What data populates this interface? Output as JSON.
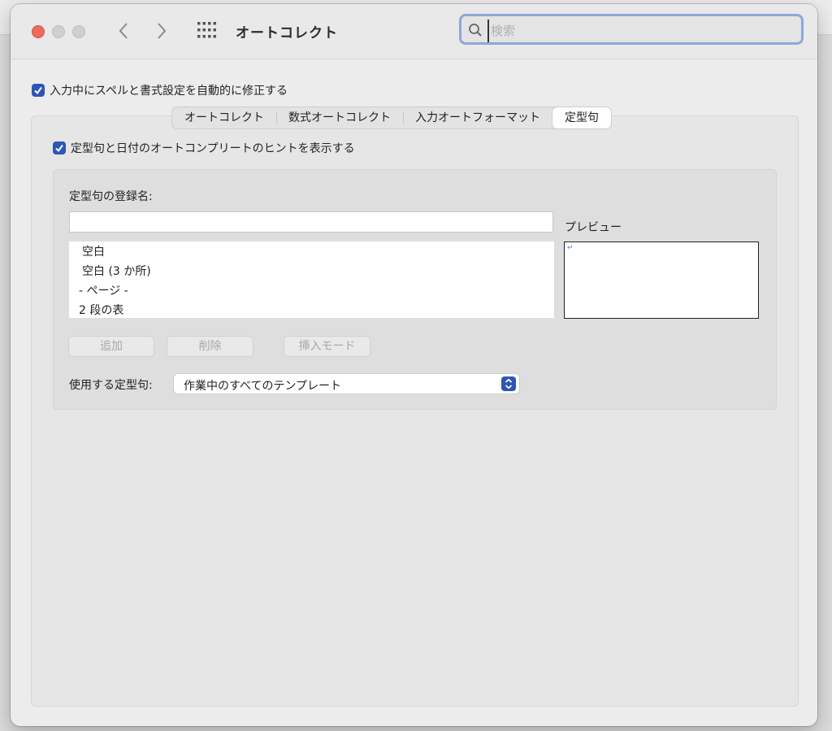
{
  "window": {
    "title": "オートコレクト"
  },
  "search": {
    "placeholder": "検索"
  },
  "options": {
    "auto_fix_label": "入力中にスペルと書式設定を自動的に修正する",
    "auto_fix_checked": true,
    "hint_label": "定型句と日付のオートコンプリートのヒントを表示する",
    "hint_checked": true
  },
  "tabs": [
    {
      "label": "オートコレクト",
      "active": false
    },
    {
      "label": "数式オートコレクト",
      "active": false
    },
    {
      "label": "入力オートフォーマット",
      "active": false
    },
    {
      "label": "定型句",
      "active": true
    }
  ],
  "autotext": {
    "name_label": "定型句の登録名:",
    "name_value": "",
    "preview_label": "プレビュー",
    "preview_mark": "↵",
    "entries": [
      "空白",
      "空白 (3 か所)",
      "- ページ -",
      "2 段の表"
    ],
    "add_label": "追加",
    "delete_label": "削除",
    "insert_mode_label": "挿入モード",
    "source_label": "使用する定型句:",
    "source_value": "作業中のすべてのテンプレート"
  },
  "colors": {
    "accent": "#2d56b8",
    "close": "#ed6a5e"
  }
}
